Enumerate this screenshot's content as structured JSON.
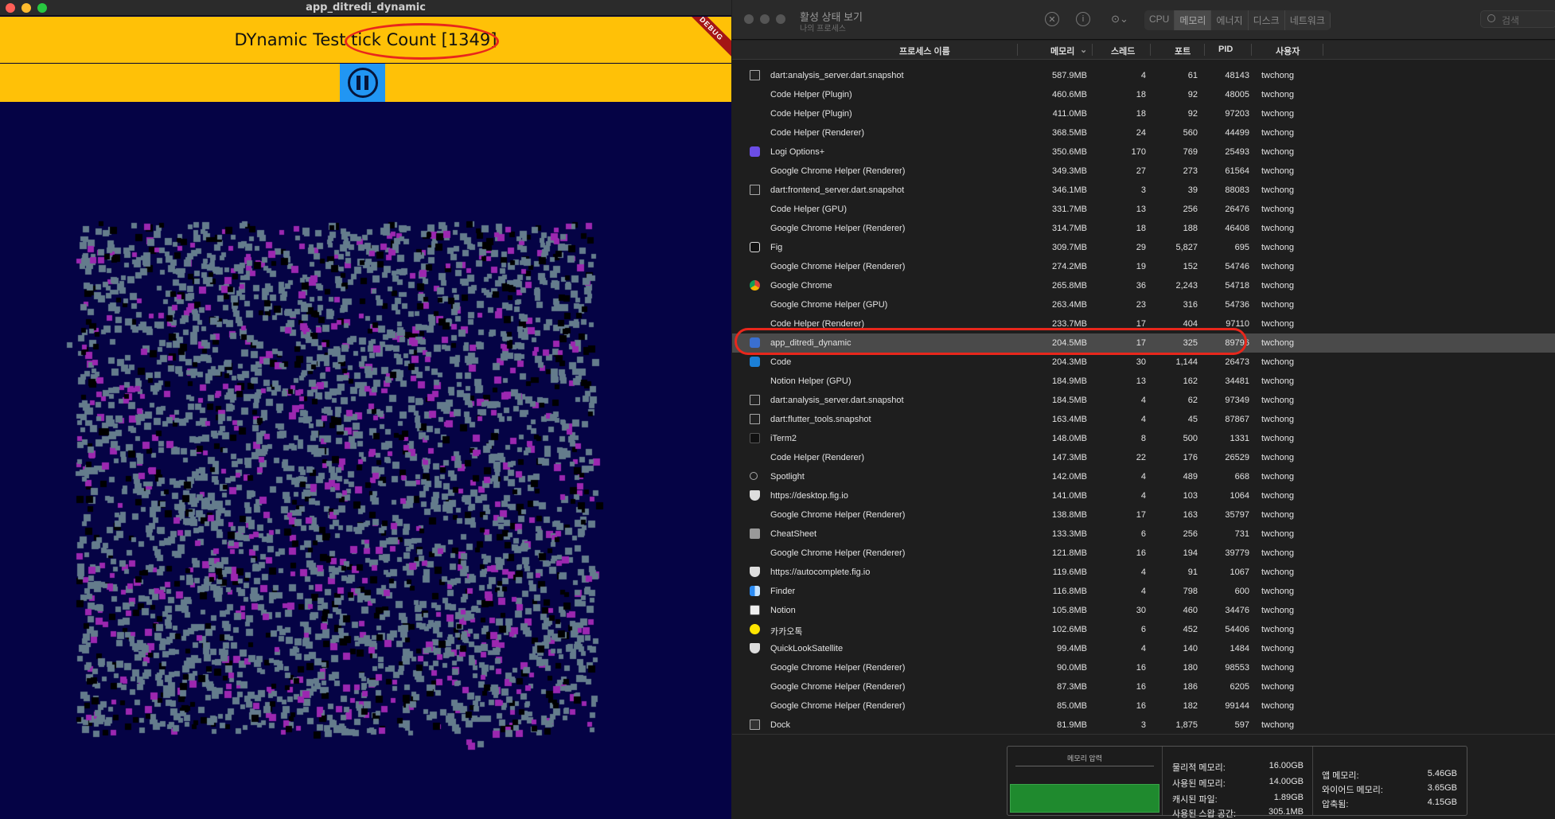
{
  "app": {
    "window_title": "app_ditredi_dynamic",
    "heading_prefix": "DYnamic Test ",
    "tick_label": "tick Count [1349]",
    "debug_banner": "DEBUG",
    "pause_icon": "pause-circle-icon",
    "colors": {
      "appbar": "#ffc107",
      "canvas_bg": "#050345",
      "pause_button": "#2196f3",
      "particle_gray": "#647c8c",
      "particle_purple": "#9c27b0",
      "particle_black": "#000000",
      "annotation": "#e8271c"
    }
  },
  "monitor": {
    "title": "활성 상태 보기",
    "subtitle": "나의 프로세스",
    "tabs": [
      "CPU",
      "메모리",
      "에너지",
      "디스크",
      "네트워크"
    ],
    "active_tab": "메모리",
    "search_placeholder": "검색",
    "columns": {
      "name": "프로세스 이름",
      "memory": "메모리",
      "threads": "스레드",
      "ports": "포트",
      "pid": "PID",
      "user": "사용자"
    },
    "selected_process": "app_ditredi_dynamic",
    "processes": [
      {
        "icon": "terminal-icon",
        "name": "dart:analysis_server.dart.snapshot",
        "memory": "587.9MB",
        "threads": "4",
        "ports": "61",
        "pid": "48143",
        "user": "twchong"
      },
      {
        "icon": "",
        "name": "Code Helper (Plugin)",
        "memory": "460.6MB",
        "threads": "18",
        "ports": "92",
        "pid": "48005",
        "user": "twchong"
      },
      {
        "icon": "",
        "name": "Code Helper (Plugin)",
        "memory": "411.0MB",
        "threads": "18",
        "ports": "92",
        "pid": "97203",
        "user": "twchong"
      },
      {
        "icon": "",
        "name": "Code Helper (Renderer)",
        "memory": "368.5MB",
        "threads": "24",
        "ports": "560",
        "pid": "44499",
        "user": "twchong"
      },
      {
        "icon": "logi-icon",
        "name": "Logi Options+",
        "memory": "350.6MB",
        "threads": "170",
        "ports": "769",
        "pid": "25493",
        "user": "twchong"
      },
      {
        "icon": "",
        "name": "Google Chrome Helper (Renderer)",
        "memory": "349.3MB",
        "threads": "27",
        "ports": "273",
        "pid": "61564",
        "user": "twchong"
      },
      {
        "icon": "terminal-icon",
        "name": "dart:frontend_server.dart.snapshot",
        "memory": "346.1MB",
        "threads": "3",
        "ports": "39",
        "pid": "88083",
        "user": "twchong"
      },
      {
        "icon": "",
        "name": "Code Helper (GPU)",
        "memory": "331.7MB",
        "threads": "13",
        "ports": "256",
        "pid": "26476",
        "user": "twchong"
      },
      {
        "icon": "",
        "name": "Google Chrome Helper (Renderer)",
        "memory": "314.7MB",
        "threads": "18",
        "ports": "188",
        "pid": "46408",
        "user": "twchong"
      },
      {
        "icon": "fig-icon",
        "name": "Fig",
        "memory": "309.7MB",
        "threads": "29",
        "ports": "5,827",
        "pid": "695",
        "user": "twchong"
      },
      {
        "icon": "",
        "name": "Google Chrome Helper (Renderer)",
        "memory": "274.2MB",
        "threads": "19",
        "ports": "152",
        "pid": "54746",
        "user": "twchong"
      },
      {
        "icon": "chrome-icon",
        "name": "Google Chrome",
        "memory": "265.8MB",
        "threads": "36",
        "ports": "2,243",
        "pid": "54718",
        "user": "twchong"
      },
      {
        "icon": "",
        "name": "Google Chrome Helper (GPU)",
        "memory": "263.4MB",
        "threads": "23",
        "ports": "316",
        "pid": "54736",
        "user": "twchong"
      },
      {
        "icon": "",
        "name": "Code Helper (Renderer)",
        "memory": "233.7MB",
        "threads": "17",
        "ports": "404",
        "pid": "97110",
        "user": "twchong"
      },
      {
        "icon": "dart-app-icon",
        "name": "app_ditredi_dynamic",
        "memory": "204.5MB",
        "threads": "17",
        "ports": "325",
        "pid": "89796",
        "user": "twchong"
      },
      {
        "icon": "vscode-icon",
        "name": "Code",
        "memory": "204.3MB",
        "threads": "30",
        "ports": "1,144",
        "pid": "26473",
        "user": "twchong"
      },
      {
        "icon": "",
        "name": "Notion Helper (GPU)",
        "memory": "184.9MB",
        "threads": "13",
        "ports": "162",
        "pid": "34481",
        "user": "twchong"
      },
      {
        "icon": "terminal-icon",
        "name": "dart:analysis_server.dart.snapshot",
        "memory": "184.5MB",
        "threads": "4",
        "ports": "62",
        "pid": "97349",
        "user": "twchong"
      },
      {
        "icon": "terminal-icon",
        "name": "dart:flutter_tools.snapshot",
        "memory": "163.4MB",
        "threads": "4",
        "ports": "45",
        "pid": "87867",
        "user": "twchong"
      },
      {
        "icon": "iterm-icon",
        "name": "iTerm2",
        "memory": "148.0MB",
        "threads": "8",
        "ports": "500",
        "pid": "1331",
        "user": "twchong"
      },
      {
        "icon": "",
        "name": "Code Helper (Renderer)",
        "memory": "147.3MB",
        "threads": "22",
        "ports": "176",
        "pid": "26529",
        "user": "twchong"
      },
      {
        "icon": "spotlight-icon",
        "name": "Spotlight",
        "memory": "142.0MB",
        "threads": "4",
        "ports": "489",
        "pid": "668",
        "user": "twchong"
      },
      {
        "icon": "shield-icon",
        "name": "https://desktop.fig.io",
        "memory": "141.0MB",
        "threads": "4",
        "ports": "103",
        "pid": "1064",
        "user": "twchong"
      },
      {
        "icon": "",
        "name": "Google Chrome Helper (Renderer)",
        "memory": "138.8MB",
        "threads": "17",
        "ports": "163",
        "pid": "35797",
        "user": "twchong"
      },
      {
        "icon": "cheatsheet-icon",
        "name": "CheatSheet",
        "memory": "133.3MB",
        "threads": "6",
        "ports": "256",
        "pid": "731",
        "user": "twchong"
      },
      {
        "icon": "",
        "name": "Google Chrome Helper (Renderer)",
        "memory": "121.8MB",
        "threads": "16",
        "ports": "194",
        "pid": "39779",
        "user": "twchong"
      },
      {
        "icon": "shield-icon",
        "name": "https://autocomplete.fig.io",
        "memory": "119.6MB",
        "threads": "4",
        "ports": "91",
        "pid": "1067",
        "user": "twchong"
      },
      {
        "icon": "finder-icon",
        "name": "Finder",
        "memory": "116.8MB",
        "threads": "4",
        "ports": "798",
        "pid": "600",
        "user": "twchong"
      },
      {
        "icon": "notion-icon",
        "name": "Notion",
        "memory": "105.8MB",
        "threads": "30",
        "ports": "460",
        "pid": "34476",
        "user": "twchong"
      },
      {
        "icon": "kakaotalk-icon",
        "name": "카카오톡",
        "memory": "102.6MB",
        "threads": "6",
        "ports": "452",
        "pid": "54406",
        "user": "twchong"
      },
      {
        "icon": "shield-icon",
        "name": "QuickLookSatellite",
        "memory": "99.4MB",
        "threads": "4",
        "ports": "140",
        "pid": "1484",
        "user": "twchong"
      },
      {
        "icon": "",
        "name": "Google Chrome Helper (Renderer)",
        "memory": "90.0MB",
        "threads": "16",
        "ports": "180",
        "pid": "98553",
        "user": "twchong"
      },
      {
        "icon": "",
        "name": "Google Chrome Helper (Renderer)",
        "memory": "87.3MB",
        "threads": "16",
        "ports": "186",
        "pid": "6205",
        "user": "twchong"
      },
      {
        "icon": "",
        "name": "Google Chrome Helper (Renderer)",
        "memory": "85.0MB",
        "threads": "16",
        "ports": "182",
        "pid": "99144",
        "user": "twchong"
      },
      {
        "icon": "dock-icon",
        "name": "Dock",
        "memory": "81.9MB",
        "threads": "3",
        "ports": "1,875",
        "pid": "597",
        "user": "twchong"
      }
    ],
    "footer": {
      "pressure_label": "메모리 압력",
      "physical_label": "물리적 메모리:",
      "physical": "16.00GB",
      "used_label": "사용된 메모리:",
      "used": "14.00GB",
      "cached_label": "캐시된 파일:",
      "cached": "1.89GB",
      "swap_label": "사용된 스왑 공간:",
      "swap": "305.1MB",
      "app_label": "앱 메모리:",
      "app": "5.46GB",
      "wired_label": "와이어드 메모리:",
      "wired": "3.65GB",
      "compressed_label": "압축됨:",
      "compressed": "4.15GB"
    }
  }
}
